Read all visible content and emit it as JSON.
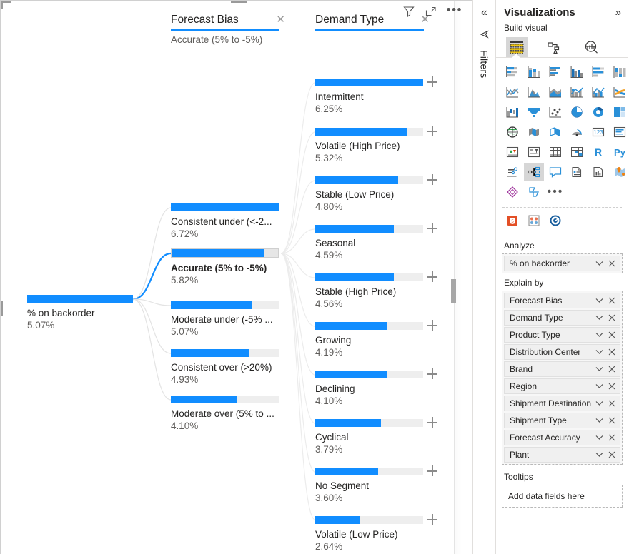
{
  "visual": {
    "header_icons": [
      {
        "name": "filter-icon",
        "title": "Filters"
      },
      {
        "name": "focus-mode-icon",
        "title": "Focus mode"
      },
      {
        "name": "more-options-icon",
        "title": "More options",
        "glyph": "•••"
      }
    ]
  },
  "tree": {
    "root": {
      "label": "% on backorder",
      "value": "5.07%",
      "fill_pct": 100
    },
    "columns": [
      {
        "title": "Forecast Bias",
        "subtitle": "Accurate (5% to -5%)",
        "close_glyph": "✕"
      },
      {
        "title": "Demand Type",
        "subtitle": "",
        "close_glyph": "✕"
      }
    ],
    "level1": [
      {
        "label": "Consistent under (<-2...",
        "value": "6.72%",
        "fill_pct": 100,
        "selected": false
      },
      {
        "label": "Accurate (5% to -5%)",
        "value": "5.82%",
        "fill_pct": 87,
        "selected": true
      },
      {
        "label": "Moderate under (-5% ...",
        "value": "5.07%",
        "fill_pct": 75,
        "selected": false
      },
      {
        "label": "Consistent over (>20%)",
        "value": "4.93%",
        "fill_pct": 73,
        "selected": false
      },
      {
        "label": "Moderate over (5% to ...",
        "value": "4.10%",
        "fill_pct": 61,
        "selected": false
      }
    ],
    "level2": [
      {
        "label": "Intermittent",
        "value": "6.25%",
        "fill_pct": 100
      },
      {
        "label": "Volatile (High Price)",
        "value": "5.32%",
        "fill_pct": 85
      },
      {
        "label": "Stable (Low Price)",
        "value": "4.80%",
        "fill_pct": 77
      },
      {
        "label": "Seasonal",
        "value": "4.59%",
        "fill_pct": 73
      },
      {
        "label": "Stable (High Price)",
        "value": "4.56%",
        "fill_pct": 73
      },
      {
        "label": "Growing",
        "value": "4.19%",
        "fill_pct": 67
      },
      {
        "label": "Declining",
        "value": "4.10%",
        "fill_pct": 66
      },
      {
        "label": "Cyclical",
        "value": "3.79%",
        "fill_pct": 61
      },
      {
        "label": "No Segment",
        "value": "3.60%",
        "fill_pct": 58
      },
      {
        "label": "Volatile (Low Price)",
        "value": "2.64%",
        "fill_pct": 42
      }
    ]
  },
  "chart_data": {
    "type": "bar",
    "title": "Decomposition tree: % on backorder",
    "measure": "% on backorder",
    "root_value": 5.07,
    "levels": [
      {
        "field": "Forecast Bias",
        "categories": [
          "Consistent under (<-20%)",
          "Accurate (5% to -5%)",
          "Moderate under (-5% to -20%)",
          "Consistent over (>20%)",
          "Moderate over (5% to 20%)"
        ],
        "values": [
          6.72,
          5.82,
          5.07,
          4.93,
          4.1
        ],
        "selected": "Accurate (5% to -5%)"
      },
      {
        "field": "Demand Type",
        "categories": [
          "Intermittent",
          "Volatile (High Price)",
          "Stable (Low Price)",
          "Seasonal",
          "Stable (High Price)",
          "Growing",
          "Declining",
          "Cyclical",
          "No Segment",
          "Volatile (Low Price)"
        ],
        "values": [
          6.25,
          5.32,
          4.8,
          4.59,
          4.56,
          4.19,
          4.1,
          3.79,
          3.6,
          2.64
        ]
      }
    ],
    "xlabel": "",
    "ylabel": "% on backorder",
    "grid": false,
    "legend": "none",
    "accent_color": "#118DFF",
    "track_color": "#EEEEEE"
  },
  "rail": {
    "collapse_glyph": "«",
    "label": "Filters",
    "icon": "filter-arrow-icon"
  },
  "visualizations": {
    "title": "Visualizations",
    "expand_glyph": "»",
    "subtitle": "Build visual",
    "tabs": [
      {
        "name": "build-visual-tab",
        "icon": "fields-table-icon",
        "active": true
      },
      {
        "name": "format-visual-tab",
        "icon": "paint-roller-icon",
        "active": false
      },
      {
        "name": "analytics-tab",
        "icon": "magnifier-chart-icon",
        "active": false
      }
    ],
    "gallery_row1": [
      "stacked-bar-chart-icon",
      "stacked-column-chart-icon",
      "clustered-bar-chart-icon",
      "clustered-column-chart-icon",
      "100-stacked-bar-chart-icon",
      "100-stacked-column-chart-icon"
    ],
    "gallery_row2": [
      "line-chart-icon",
      "area-chart-icon",
      "stacked-area-chart-icon",
      "line-stacked-column-chart-icon",
      "line-clustered-column-chart-icon",
      "ribbon-chart-icon"
    ],
    "gallery_row3": [
      "waterfall-chart-icon",
      "funnel-chart-icon",
      "scatter-chart-icon",
      "pie-chart-icon",
      "donut-chart-icon",
      "treemap-icon"
    ],
    "gallery_row4": [
      "map-icon",
      "filled-map-icon",
      "shape-map-icon",
      "azure-map-icon",
      "gauge-icon",
      "card-icon",
      "multi-row-card-icon"
    ],
    "gallery_row5": [
      "kpi-icon",
      "slicer-icon",
      "table-icon",
      "matrix-icon",
      "r-script-visual-icon",
      "python-visual-icon"
    ],
    "gallery_row6": [
      "key-influencers-icon",
      "decomposition-tree-icon",
      "qa-visual-icon",
      "narrative-icon",
      "paginated-report-icon",
      "arcgis-map-icon"
    ],
    "gallery_row7": [
      "power-apps-icon",
      "power-automate-icon",
      "more-visuals-icon"
    ],
    "gallery_row8": [
      "html-visual-icon",
      "custom-visual-icon",
      "visual-marketplace-icon"
    ],
    "more_glyph": "•••",
    "selected_visual": "decomposition-tree-icon",
    "analyze": {
      "label": "Analyze",
      "fields": [
        {
          "name": "% on backorder",
          "chevron": "⌄",
          "close": "✕"
        }
      ]
    },
    "explain_by": {
      "label": "Explain by",
      "fields": [
        {
          "name": "Forecast Bias",
          "chevron": "⌄",
          "close": "✕"
        },
        {
          "name": "Demand Type",
          "chevron": "⌄",
          "close": "✕"
        },
        {
          "name": "Product Type",
          "chevron": "⌄",
          "close": "✕"
        },
        {
          "name": "Distribution Center",
          "chevron": "⌄",
          "close": "✕"
        },
        {
          "name": "Brand",
          "chevron": "⌄",
          "close": "✕"
        },
        {
          "name": "Region",
          "chevron": "⌄",
          "close": "✕"
        },
        {
          "name": "Shipment Destination",
          "chevron": "⌄",
          "close": "✕"
        },
        {
          "name": "Shipment Type",
          "chevron": "⌄",
          "close": "✕"
        },
        {
          "name": "Forecast Accuracy",
          "chevron": "⌄",
          "close": "✕"
        },
        {
          "name": "Plant",
          "chevron": "⌄",
          "close": "✕"
        }
      ]
    },
    "tooltips": {
      "label": "Tooltips",
      "placeholder": "Add data fields here"
    }
  }
}
